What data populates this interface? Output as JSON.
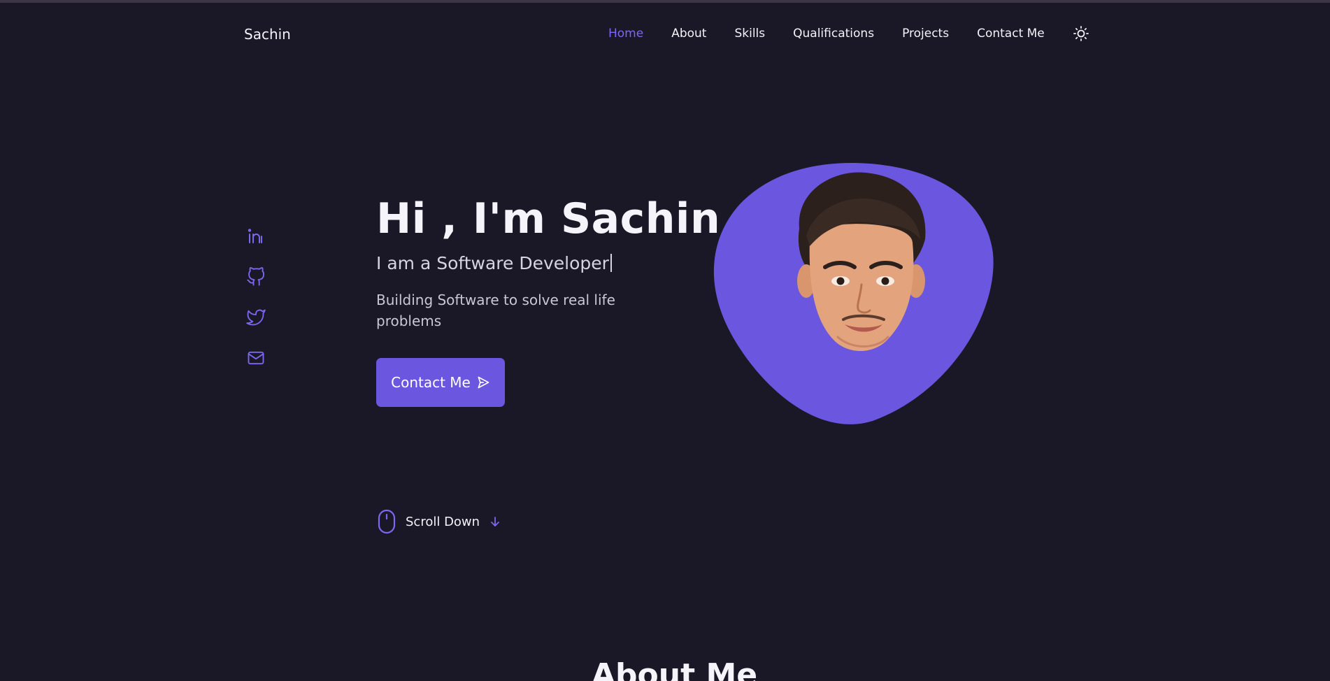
{
  "header": {
    "logo": "Sachin",
    "nav": [
      {
        "label": "Home",
        "active": true
      },
      {
        "label": "About"
      },
      {
        "label": "Skills"
      },
      {
        "label": "Qualifications"
      },
      {
        "label": "Projects"
      },
      {
        "label": "Contact Me"
      }
    ],
    "theme_icon": "sun-icon"
  },
  "socials": [
    {
      "icon": "linkedin-icon"
    },
    {
      "icon": "github-icon"
    },
    {
      "icon": "twitter-icon"
    },
    {
      "icon": "mail-icon"
    }
  ],
  "hero": {
    "title": "Hi , I'm Sachin",
    "subtitle": "I am a Software Developer",
    "description": "Building Software to solve real life problems",
    "button_label": "Contact Me",
    "button_icon": "send-icon"
  },
  "scroll": {
    "label": "Scroll Down",
    "mouse_icon": "mouse-icon",
    "arrow_icon": "arrow-down-icon"
  },
  "next_section": {
    "title": "About Me"
  },
  "colors": {
    "background": "#1a1726",
    "accent": "#6b56e0",
    "accent_light": "#7b68f0",
    "text": "#f3f2f7"
  }
}
